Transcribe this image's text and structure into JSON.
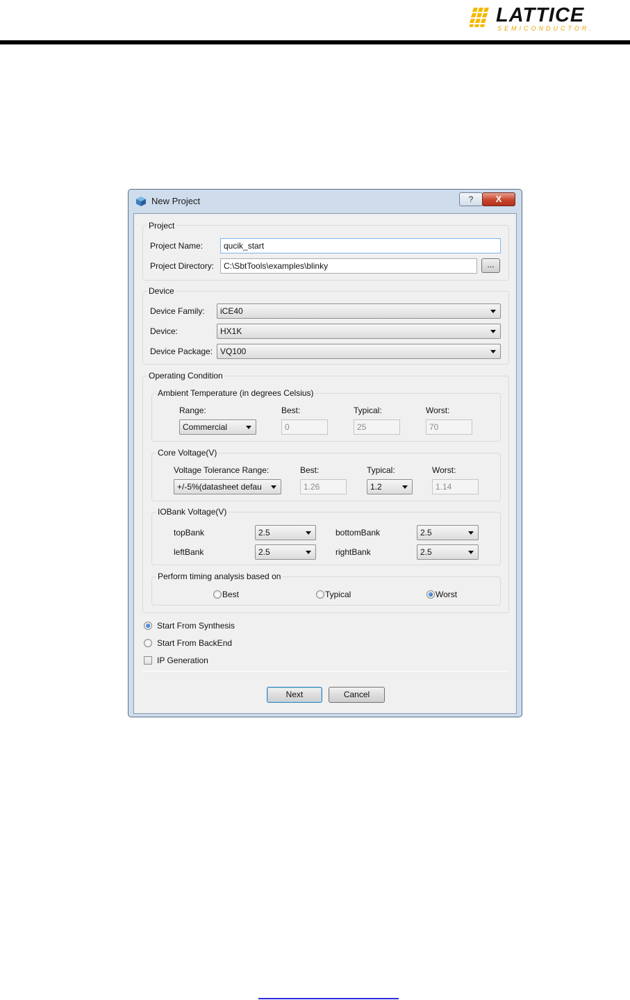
{
  "header": {
    "logo_text": "LATTICE",
    "logo_sub": "SEMICONDUCTOR."
  },
  "window": {
    "title": "New Project",
    "help_glyph": "?",
    "close_glyph": "X"
  },
  "project": {
    "group_title": "Project",
    "name_label": "Project Name:",
    "name_value": "qucik_start",
    "dir_label": "Project Directory:",
    "dir_value": "C:\\SbtTools\\examples\\blinky",
    "browse_label": "..."
  },
  "device": {
    "group_title": "Device",
    "family_label": "Device Family:",
    "family_value": "iCE40",
    "device_label": "Device:",
    "device_value": "HX1K",
    "package_label": "Device Package:",
    "package_value": "VQ100"
  },
  "operating": {
    "group_title": "Operating Condition",
    "ambient": {
      "title": "Ambient Temperature (in degrees Celsius)",
      "range_label": "Range:",
      "best_label": "Best:",
      "typical_label": "Typical:",
      "worst_label": "Worst:",
      "range_value": "Commercial",
      "best_value": "0",
      "typical_value": "25",
      "worst_value": "70"
    },
    "core": {
      "title": "Core Voltage(V)",
      "tolerance_label": "Voltage Tolerance Range:",
      "best_label": "Best:",
      "typical_label": "Typical:",
      "worst_label": "Worst:",
      "tolerance_value": "+/-5%(datasheet defau",
      "best_value": "1.26",
      "typical_value": "1.2",
      "worst_value": "1.14"
    },
    "iobank": {
      "title": "IOBank Voltage(V)",
      "top_label": "topBank",
      "top_value": "2.5",
      "bottom_label": "bottomBank",
      "bottom_value": "2.5",
      "left_label": "leftBank",
      "left_value": "2.5",
      "right_label": "rightBank",
      "right_value": "2.5"
    },
    "timing": {
      "title": "Perform timing analysis based on",
      "best_label": "Best",
      "typical_label": "Typical",
      "worst_label": "Worst",
      "selected": "Worst"
    }
  },
  "flow": {
    "synthesis_label": "Start From Synthesis",
    "backend_label": "Start From BackEnd",
    "ipgen_label": "IP Generation",
    "selected": "Start From Synthesis",
    "ipgen_checked": false
  },
  "buttons": {
    "next_label": "Next",
    "cancel_label": "Cancel"
  },
  "colors": {
    "logo_yellow": "#f5b800",
    "window_frame": "#cfdcec",
    "close_red": "#c8442c",
    "link_blue": "#2a2ae0"
  }
}
